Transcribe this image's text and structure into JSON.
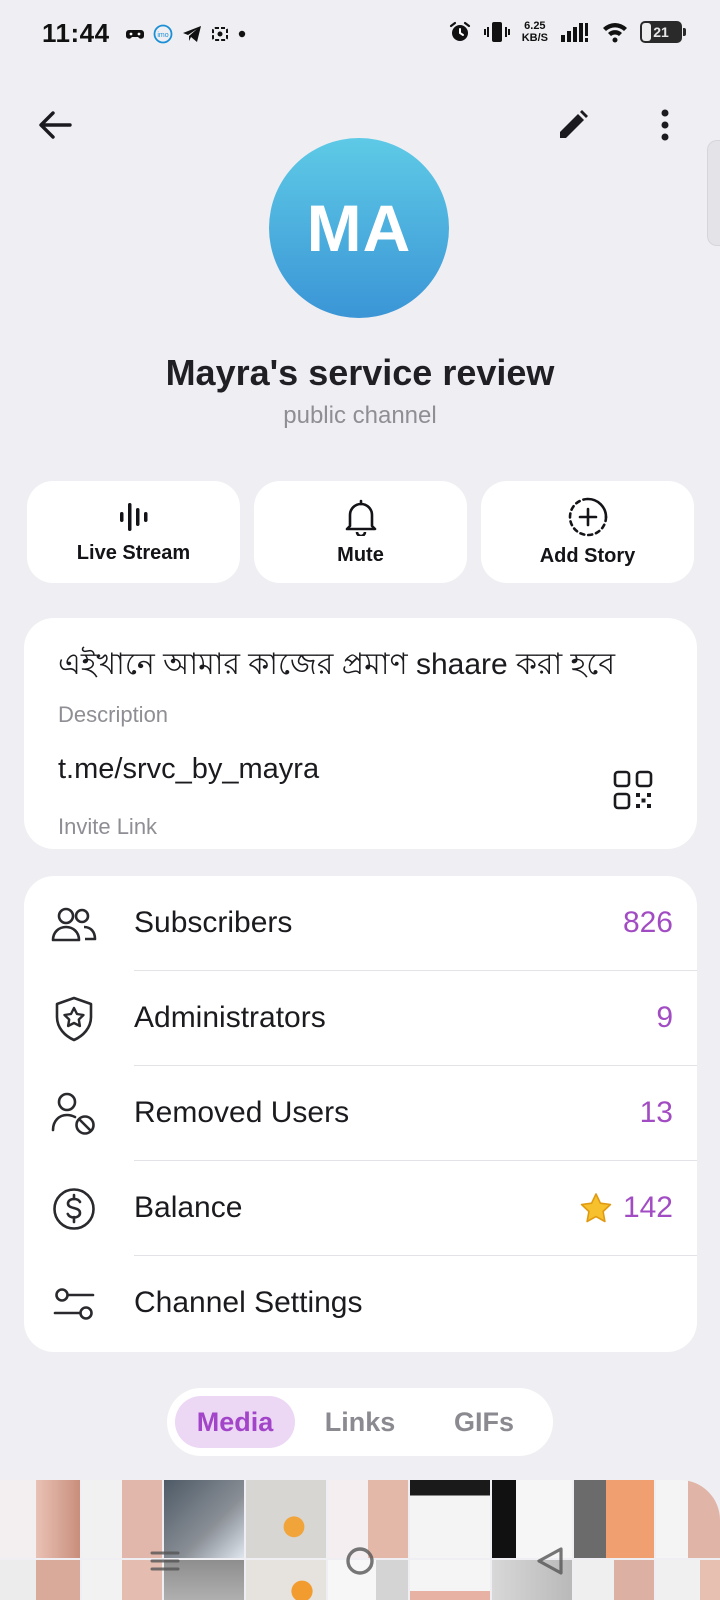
{
  "status_bar": {
    "time": "11:44",
    "net_speed_value": "6.25",
    "net_speed_unit": "KB/S",
    "battery": "21",
    "left_icons": [
      "game-controller-icon",
      "imo-icon",
      "telegram-icon",
      "screenshot-icon",
      "dot-icon"
    ],
    "right_icons": [
      "alarm-icon",
      "vibrate-icon",
      "signal-icon",
      "wifi-icon",
      "battery-icon"
    ]
  },
  "header": {
    "avatar_initials": "MA",
    "title": "Mayra's service review",
    "subtitle": "public channel"
  },
  "actions": [
    {
      "label": "Live Stream",
      "icon": "live-stream-icon"
    },
    {
      "label": "Mute",
      "icon": "bell-icon"
    },
    {
      "label": "Add Story",
      "icon": "add-story-icon"
    }
  ],
  "info": {
    "description": "এইখানে আমার কাজের প্রমাণ shaare করা হবে",
    "description_label": "Description",
    "invite_link": "t.me/srvc_by_mayra",
    "invite_link_label": "Invite Link"
  },
  "list": [
    {
      "label": "Subscribers",
      "value": "826",
      "icon": "people-icon"
    },
    {
      "label": "Administrators",
      "value": "9",
      "icon": "shield-star-icon"
    },
    {
      "label": "Removed Users",
      "value": "13",
      "icon": "user-blocked-icon"
    },
    {
      "label": "Balance",
      "value": "142",
      "icon": "dollar-circle-icon"
    },
    {
      "label": "Channel Settings",
      "value": "",
      "icon": "sliders-icon"
    }
  ],
  "tabs": [
    {
      "label": "Media",
      "active": true
    },
    {
      "label": "Links",
      "active": false
    },
    {
      "label": "GIFs",
      "active": false
    }
  ],
  "colors": {
    "background": "#efeff3",
    "accent": "#a24cc4",
    "avatar_top": "#5ecae6",
    "avatar_bottom": "#3b95d6",
    "tab_active_bg": "#ecd7f5"
  }
}
